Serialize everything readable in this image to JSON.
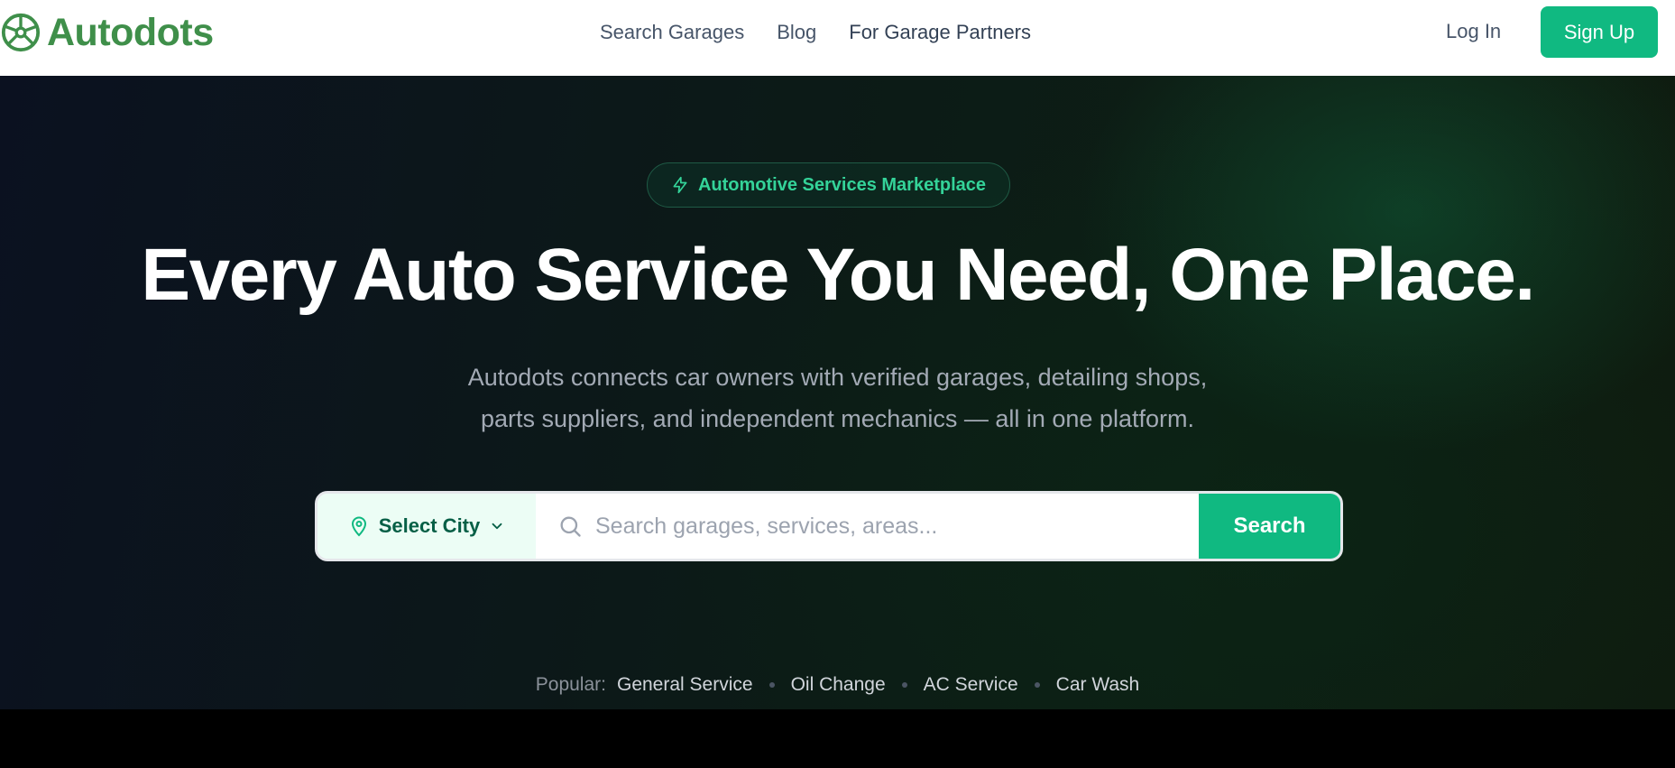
{
  "brand": {
    "name": "Autodots",
    "color": "#3f8f4a",
    "icon": "steering-wheel-icon"
  },
  "nav": {
    "items": [
      {
        "label": "Search Garages"
      },
      {
        "label": "Blog"
      },
      {
        "label": "For Garage Partners"
      }
    ],
    "login_label": "Log In",
    "signup_label": "Sign Up"
  },
  "hero": {
    "badge": {
      "icon": "lightning-icon",
      "label": "Automotive Services Marketplace"
    },
    "headline": "Every Auto Service You Need, One Place.",
    "subtitle_line1": "Autodots connects car owners with verified garages, detailing shops,",
    "subtitle_line2": "parts suppliers, and independent mechanics — all in one platform."
  },
  "search": {
    "city_label": "Select City",
    "placeholder": "Search garages, services, areas...",
    "button_label": "Search"
  },
  "popular": {
    "label": "Popular:",
    "tags": [
      "General Service",
      "Oil Change",
      "AC Service",
      "Car Wash"
    ]
  },
  "colors": {
    "accent": "#10b981",
    "accent_text": "#34d399",
    "city_bg": "#ecfdf5"
  }
}
